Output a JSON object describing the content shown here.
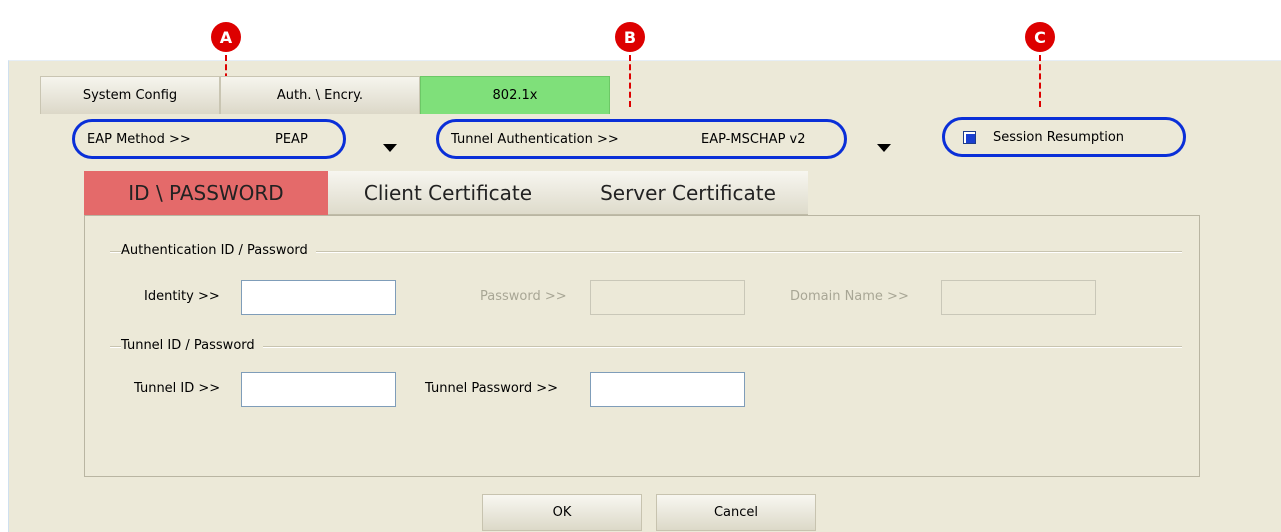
{
  "markers": {
    "a": "A",
    "b": "B",
    "c": "C"
  },
  "top_tabs": [
    "System Config",
    "Auth. \\ Encry.",
    "802.1x"
  ],
  "eap": {
    "label": "EAP Method >>",
    "value": "PEAP"
  },
  "tunnel_auth": {
    "label": "Tunnel Authentication >>",
    "value": "EAP-MSCHAP v2"
  },
  "session": {
    "label": "Session Resumption",
    "checked": true
  },
  "sub_tabs": [
    "ID \\ PASSWORD",
    "Client Certificate",
    "Server Certificate"
  ],
  "auth_group": {
    "title": "Authentication ID / Password",
    "identity_label": "Identity >>",
    "password_label": "Password >>",
    "domain_label": "Domain Name >>"
  },
  "tunnel_group": {
    "title": "Tunnel ID / Password",
    "tunnel_id_label": "Tunnel ID >>",
    "tunnel_password_label": "Tunnel Password >>"
  },
  "buttons": {
    "ok": "OK",
    "cancel": "Cancel"
  },
  "colors": {
    "marker": "#dd0000",
    "oval": "#0a2fd8",
    "active_tab": "#7fe07a",
    "active_subtab": "#e46a6a"
  }
}
